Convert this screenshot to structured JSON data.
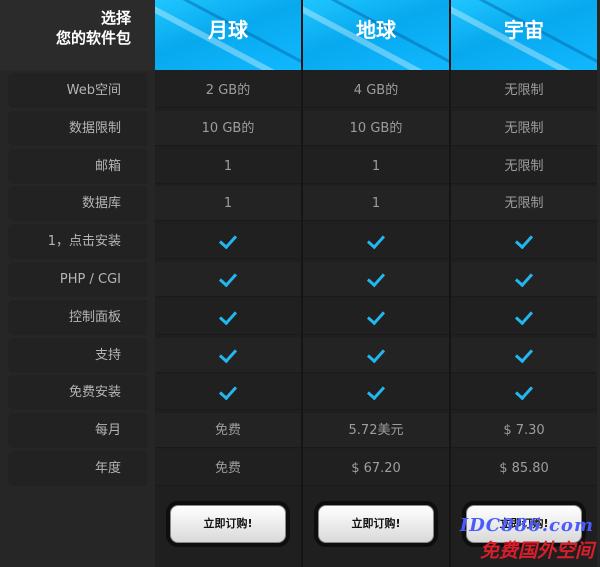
{
  "header": {
    "corner_line1": "选择",
    "corner_line2": "您的软件包",
    "plans": [
      "月球",
      "地球",
      "宇宙"
    ]
  },
  "rows": [
    {
      "label": "Web空间",
      "values": [
        "2 GB的",
        "4 GB的",
        "无限制"
      ]
    },
    {
      "label": "数据限制",
      "values": [
        "10 GB的",
        "10 GB的",
        "无限制"
      ]
    },
    {
      "label": "邮箱",
      "values": [
        "1",
        "1",
        "无限制"
      ]
    },
    {
      "label": "数据库",
      "values": [
        "1",
        "1",
        "无限制"
      ]
    },
    {
      "label": "1，点击安装",
      "values": [
        "check",
        "check",
        "check"
      ]
    },
    {
      "label": "PHP / CGI",
      "values": [
        "check",
        "check",
        "check"
      ]
    },
    {
      "label": "控制面板",
      "values": [
        "check",
        "check",
        "check"
      ]
    },
    {
      "label": "支持",
      "values": [
        "check",
        "check",
        "check"
      ]
    },
    {
      "label": "免费安装",
      "values": [
        "check",
        "check",
        "check"
      ]
    },
    {
      "label": "每月",
      "values": [
        "免费",
        "5.72美元",
        "$ 7.30"
      ]
    },
    {
      "label": "年度",
      "values": [
        "免费",
        "$ 67.20",
        "$ 85.80"
      ]
    }
  ],
  "buttons": [
    "立即订购!",
    "立即订购!",
    "立即订购!"
  ],
  "watermark": {
    "line1": "IDC886.com",
    "line2": "免费国外空间"
  },
  "colors": {
    "accent": "#11b8ff",
    "check": "#22b7ee",
    "background": "#262626"
  }
}
